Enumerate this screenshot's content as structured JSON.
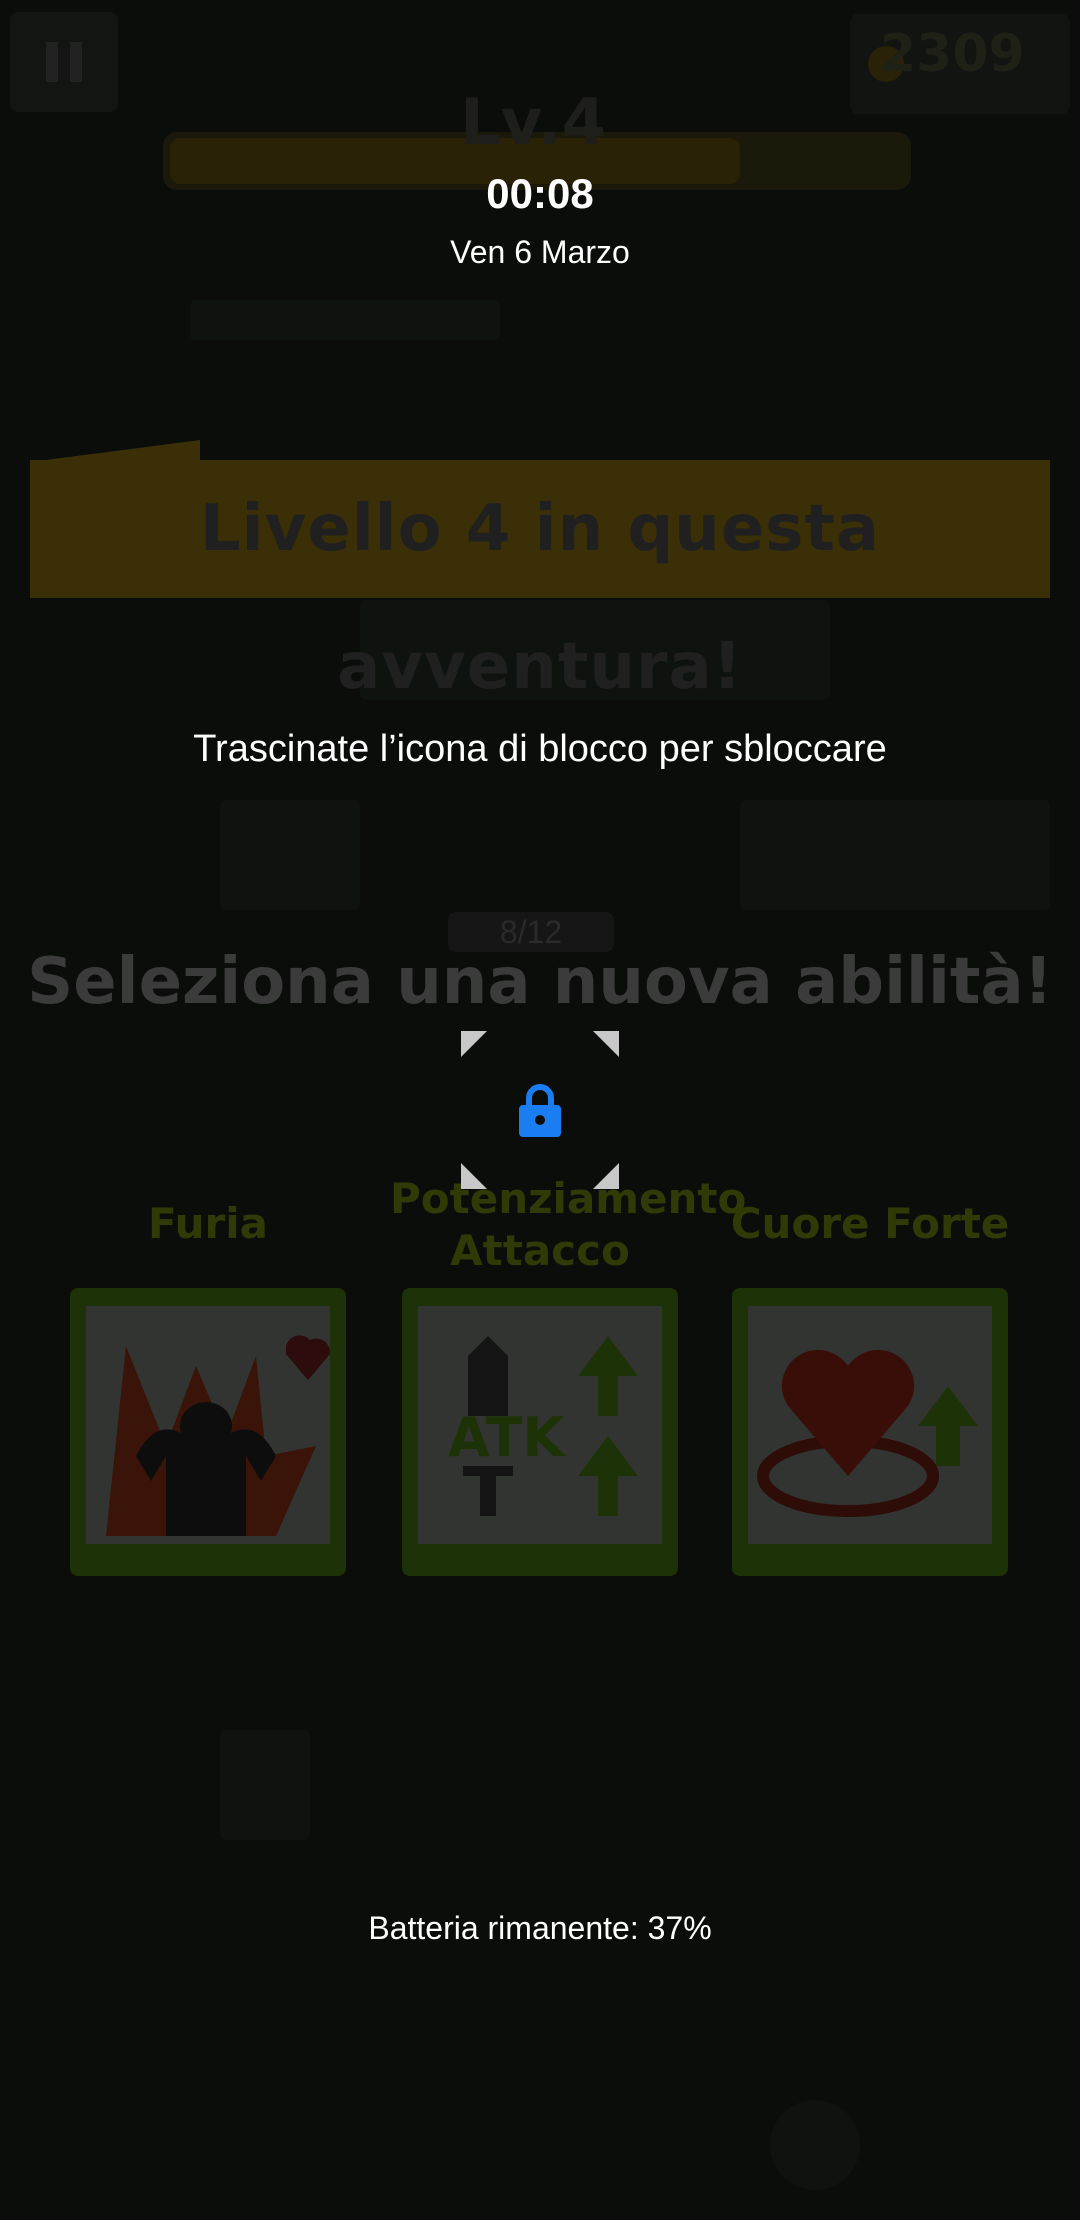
{
  "game": {
    "coins": "2309",
    "level": "Lv.4",
    "banner": "Livello 4 in questa avventura!",
    "progress": "8/12",
    "select_title": "Seleziona una nuova abilità!",
    "skills": [
      {
        "name": "Furia",
        "icon": "rage-icon"
      },
      {
        "name": "Potenziamento Attacco",
        "icon": "attack-up-icon"
      },
      {
        "name": "Cuore Forte",
        "icon": "strong-heart-icon"
      }
    ],
    "colors": {
      "banner": "#3a2f06",
      "card_border": "#1e3207"
    }
  },
  "lock_screen": {
    "time": "00:08",
    "date": "Ven 6 Marzo",
    "hint": "Trascinate l’icona di blocco per sbloccare",
    "battery": "Batteria rimanente: 37%",
    "lock_icon": "padlock-icon",
    "lock_color": "#1a7ef2"
  }
}
